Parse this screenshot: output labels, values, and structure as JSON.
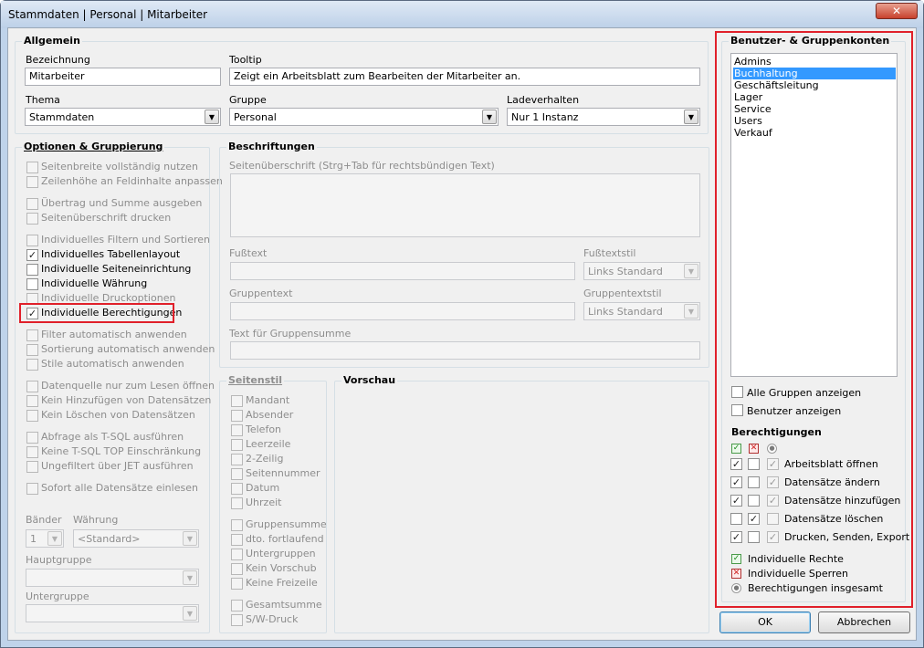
{
  "window": {
    "title": "Stammdaten | Personal | Mitarbeiter",
    "close_label": "✕"
  },
  "allgemein": {
    "title": "Allgemein",
    "bezeichnung_label": "Bezeichnung",
    "bezeichnung_value": "Mitarbeiter",
    "tooltip_label": "Tooltip",
    "tooltip_value": "Zeigt ein Arbeitsblatt zum Bearbeiten der Mitarbeiter an.",
    "thema_label": "Thema",
    "thema_value": "Stammdaten",
    "gruppe_label": "Gruppe",
    "gruppe_value": "Personal",
    "ladeverhalten_label": "Ladeverhalten",
    "ladeverhalten_value": "Nur 1 Instanz"
  },
  "optionen": {
    "title": "Optionen & Gruppierung",
    "items": [
      {
        "label": "Seitenbreite vollständig nutzen",
        "checked": false,
        "enabled": false
      },
      {
        "label": "Zeilenhöhe an Feldinhalte anpassen",
        "checked": false,
        "enabled": false
      },
      {
        "label": "Übertrag und Summe ausgeben",
        "checked": false,
        "enabled": false
      },
      {
        "label": "Seitenüberschrift drucken",
        "checked": false,
        "enabled": false
      },
      {
        "label": "Individuelles Filtern und Sortieren",
        "checked": false,
        "enabled": false
      },
      {
        "label": "Individuelles Tabellenlayout",
        "checked": true,
        "enabled": true
      },
      {
        "label": "Individuelle Seiteneinrichtung",
        "checked": false,
        "enabled": true
      },
      {
        "label": "Individuelle Währung",
        "checked": false,
        "enabled": true
      },
      {
        "label": "Individuelle Druckoptionen",
        "checked": false,
        "enabled": false
      },
      {
        "label": "Individuelle Berechtigungen",
        "checked": true,
        "enabled": true
      },
      {
        "label": "Filter automatisch anwenden",
        "checked": false,
        "enabled": false
      },
      {
        "label": "Sortierung automatisch anwenden",
        "checked": false,
        "enabled": false
      },
      {
        "label": "Stile automatisch anwenden",
        "checked": false,
        "enabled": false
      },
      {
        "label": "Datenquelle nur zum Lesen öffnen",
        "checked": false,
        "enabled": false
      },
      {
        "label": "Kein Hinzufügen von Datensätzen",
        "checked": false,
        "enabled": false
      },
      {
        "label": "Kein Löschen von Datensätzen",
        "checked": false,
        "enabled": false
      },
      {
        "label": "Abfrage als T-SQL ausführen",
        "checked": false,
        "enabled": false
      },
      {
        "label": "Keine T-SQL TOP Einschränkung",
        "checked": false,
        "enabled": false
      },
      {
        "label": "Ungefiltert über JET ausführen",
        "checked": false,
        "enabled": false
      },
      {
        "label": "Sofort alle Datensätze einlesen",
        "checked": false,
        "enabled": false
      }
    ],
    "baender_label": "Bänder",
    "baender_value": "1",
    "waehrung_label": "Währung",
    "waehrung_value": "<Standard>",
    "hauptgruppe_label": "Hauptgruppe",
    "hauptgruppe_value": "",
    "untergruppe_label": "Untergruppe",
    "untergruppe_value": ""
  },
  "beschriftungen": {
    "title": "Beschriftungen",
    "seitenueberschrift_label": "Seitenüberschrift (Strg+Tab für rechtsbündigen Text)",
    "fusstext_label": "Fußtext",
    "fusstextstil_label": "Fußtextstil",
    "fusstextstil_value": "Links Standard",
    "gruppentext_label": "Gruppentext",
    "gruppentextstil_label": "Gruppentextstil",
    "gruppentextstil_value": "Links Standard",
    "gruppensumme_label": "Text für Gruppensumme"
  },
  "seitenstil": {
    "title": "Seitenstil",
    "items": [
      {
        "label": "Mandant",
        "checked": false
      },
      {
        "label": "Absender",
        "checked": false
      },
      {
        "label": "Telefon",
        "checked": false
      },
      {
        "label": "Leerzeile",
        "checked": false
      },
      {
        "label": "2-Zeilig",
        "checked": false
      },
      {
        "label": "Seitennummer",
        "checked": false
      },
      {
        "label": "Datum",
        "checked": false
      },
      {
        "label": "Uhrzeit",
        "checked": false
      },
      {
        "label": "Gruppensumme",
        "checked": false
      },
      {
        "label": "dto. fortlaufend",
        "checked": false
      },
      {
        "label": "Untergruppen",
        "checked": false
      },
      {
        "label": "Kein Vorschub",
        "checked": false
      },
      {
        "label": "Keine Freizeile",
        "checked": false
      },
      {
        "label": "Gesamtsumme",
        "checked": false
      },
      {
        "label": "S/W-Druck",
        "checked": false
      }
    ]
  },
  "vorschau": {
    "title": "Vorschau"
  },
  "konten": {
    "title": "Benutzer- & Gruppenkonten",
    "items": [
      "Admins",
      "Buchhaltung",
      "Geschäftsleitung",
      "Lager",
      "Service",
      "Users",
      "Verkauf"
    ],
    "selected": "Buchhaltung",
    "alle_gruppen_label": "Alle Gruppen anzeigen",
    "benutzer_label": "Benutzer anzeigen",
    "berechtigungen_title": "Berechtigungen",
    "perms": [
      {
        "label": "Arbeitsblatt öffnen",
        "allow": true,
        "deny": false,
        "total": true
      },
      {
        "label": "Datensätze ändern",
        "allow": true,
        "deny": false,
        "total": true
      },
      {
        "label": "Datensätze hinzufügen",
        "allow": true,
        "deny": false,
        "total": true
      },
      {
        "label": "Datensätze löschen",
        "allow": false,
        "deny": true,
        "total": false
      },
      {
        "label": "Drucken, Senden, Export",
        "allow": true,
        "deny": false,
        "total": true
      }
    ],
    "legend_allow": "Individuelle Rechte",
    "legend_deny": "Individuelle Sperren",
    "legend_total": "Berechtigungen insgesamt"
  },
  "buttons": {
    "ok": "OK",
    "cancel": "Abbrechen"
  },
  "colors": {
    "selection": "#3399ff",
    "highlight_box": "#e0202a"
  }
}
